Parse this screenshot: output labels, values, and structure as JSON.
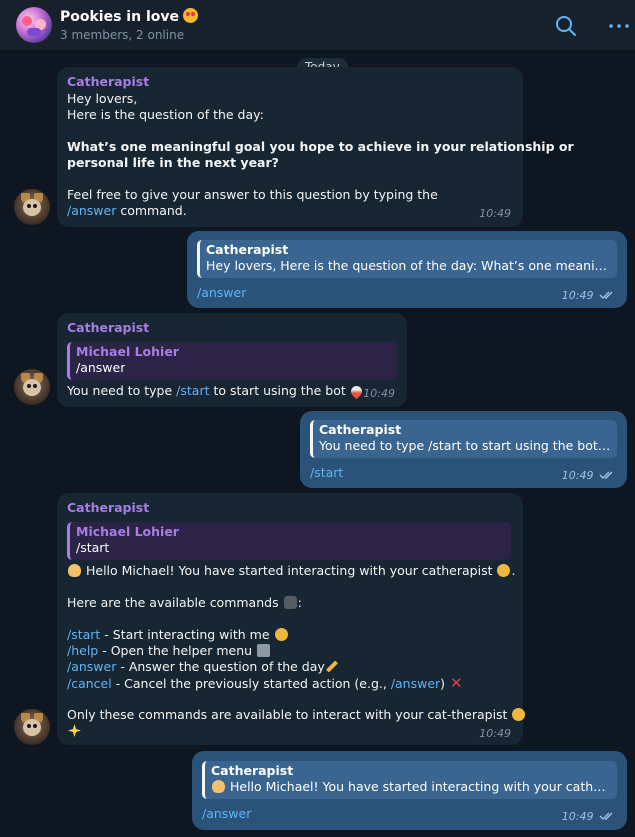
{
  "header": {
    "title": "Pookies in love",
    "subtitle": "3 members, 2 online",
    "title_emoji": "smiling-face-with-heart-eyes-icon"
  },
  "date_separator": "Today",
  "messages": [
    {
      "sender": "Catherapist",
      "lines": [
        "Hey lovers,",
        "Here is the question of the day:",
        "What’s one meaningful goal you hope to achieve in your relationship or",
        "personal life in the next year?",
        "Feel free to give your answer to this question by typing the"
      ],
      "link": "/answer",
      "after_link": " command.",
      "time": "10:49"
    },
    {
      "quote_name": "Catherapist",
      "quote_text": "Hey lovers, Here is the question of the day:  What’s one meaningf…",
      "text": "/answer",
      "time": "10:49"
    },
    {
      "sender": "Catherapist",
      "quote_name": "Michael Lohier",
      "quote_text": "/answer",
      "text_before": "You need to type ",
      "link": "/start",
      "text_after": " to start using the bot",
      "time": "10:49"
    },
    {
      "quote_name": "Catherapist",
      "quote_text": "You need to type /start to start using the bot",
      "text": "/start",
      "time": "10:49"
    },
    {
      "sender": "Catherapist",
      "quote_name": "Michael Lohier",
      "quote_text": "/start",
      "greeting": "Hello Michael! You have started interacting with your catherapist",
      "commands_intro": "Here are the available commands",
      "commands": [
        {
          "cmd": "/start",
          "desc": " - Start interacting with me"
        },
        {
          "cmd": "/help",
          "desc": " - Open the helper menu"
        },
        {
          "cmd": "/answer",
          "desc": " - Answer the question of the day"
        },
        {
          "cmd": "/cancel",
          "desc": " - Cancel the previously started action (e.g., ",
          "inner_link": "/answer",
          "desc_end": ")"
        }
      ],
      "footer": "Only these commands are available to interact with your cat-therapist",
      "time": "10:49"
    },
    {
      "quote_name": "Catherapist",
      "quote_text": "Hello Michael! You have started interacting with your cathera…",
      "text": "/answer",
      "time": "10:49"
    }
  ],
  "colors": {
    "background": "#0e1621",
    "incoming_bubble": "#182533",
    "outgoing_bubble": "#2b5278",
    "sender_name": "#a77fe3",
    "link": "#5eb5f7"
  }
}
